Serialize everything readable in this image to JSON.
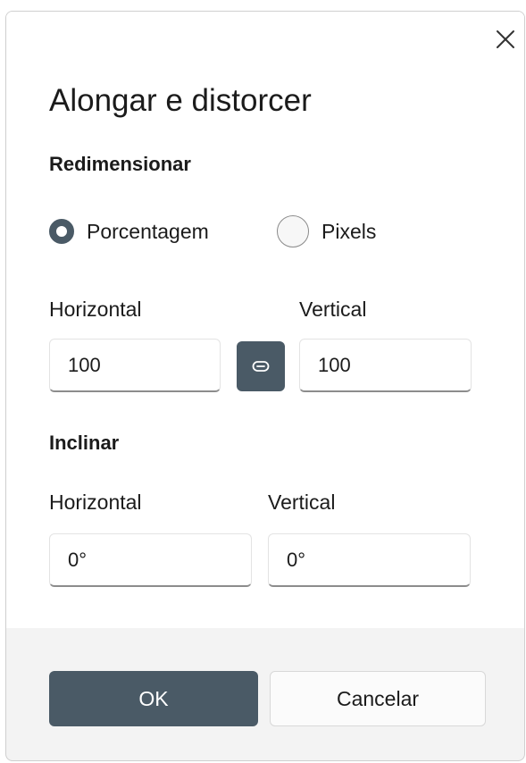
{
  "dialog": {
    "title": "Alongar e distorcer",
    "close_icon": "close-icon"
  },
  "resize": {
    "section_label": "Redimensionar",
    "options": [
      {
        "label": "Porcentagem",
        "selected": true
      },
      {
        "label": "Pixels",
        "selected": false
      }
    ],
    "horizontal_label": "Horizontal",
    "horizontal_value": "100",
    "vertical_label": "Vertical",
    "vertical_value": "100",
    "link_icon": "link-icon"
  },
  "skew": {
    "section_label": "Inclinar",
    "horizontal_label": "Horizontal",
    "horizontal_value": "0°",
    "vertical_label": "Vertical",
    "vertical_value": "0°"
  },
  "footer": {
    "ok_label": "OK",
    "cancel_label": "Cancelar"
  },
  "colors": {
    "accent": "#4a5a66",
    "footer_bg": "#f3f3f3",
    "content_bg": "#ffffff"
  }
}
